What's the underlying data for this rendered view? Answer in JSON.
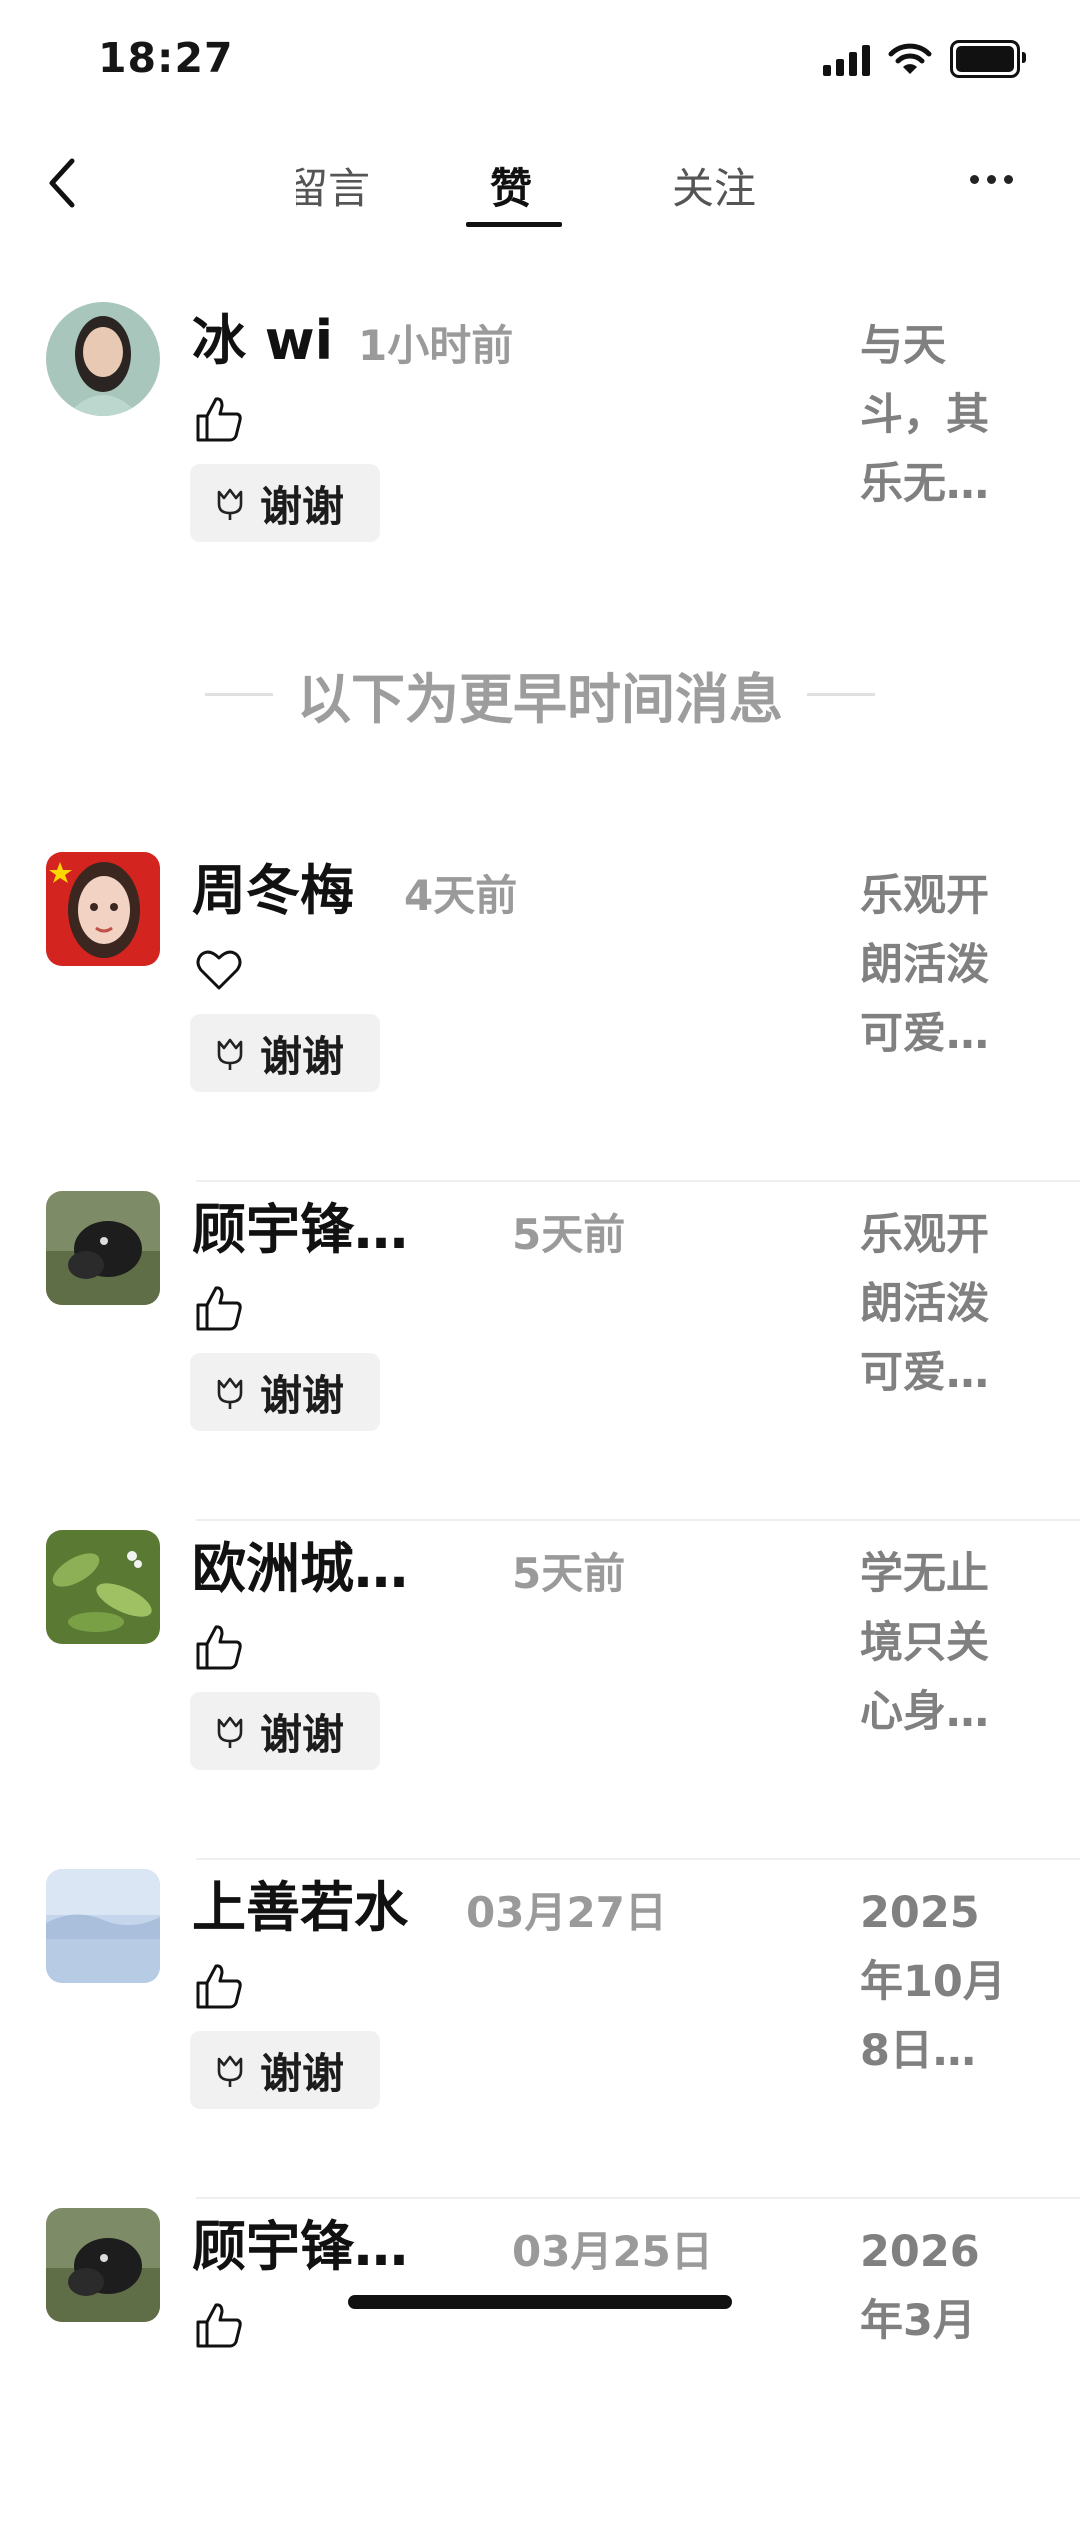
{
  "status": {
    "time": "18:27"
  },
  "nav": {
    "tabs": [
      {
        "label": "留言"
      },
      {
        "label": "赞"
      },
      {
        "label": "关注"
      }
    ]
  },
  "separator": {
    "label": "以下为更早时间消息"
  },
  "thanks_label": "谢谢",
  "rows": [
    {
      "name": "冰 wi",
      "time": "1小时前",
      "reaction": "thumbs-up-icon",
      "snippet": [
        "与天",
        "斗，其",
        "乐无…"
      ]
    },
    {
      "name": "周冬梅",
      "time": "4天前",
      "reaction": "heart-icon",
      "snippet": [
        "乐观开",
        "朗活泼",
        "可爱…"
      ]
    },
    {
      "name": "顾宇锋…",
      "time": "5天前",
      "reaction": "thumbs-up-icon",
      "snippet": [
        "乐观开",
        "朗活泼",
        "可爱…"
      ]
    },
    {
      "name": "欧洲城…",
      "time": "5天前",
      "reaction": "thumbs-up-icon",
      "snippet": [
        "学无止",
        "境只关",
        "心身…"
      ]
    },
    {
      "name": "上善若水",
      "time": "03月27日",
      "reaction": "thumbs-up-icon",
      "snippet": [
        "2025",
        "年10月",
        "8日…"
      ]
    },
    {
      "name": "顾宇锋…",
      "time": "03月25日",
      "reaction": "thumbs-up-icon",
      "snippet": [
        "2026",
        "年3月",
        ""
      ]
    }
  ],
  "colors": {
    "text": "#161616",
    "muted": "#9a9a9a",
    "thanks_bg": "#f1f1f1"
  }
}
